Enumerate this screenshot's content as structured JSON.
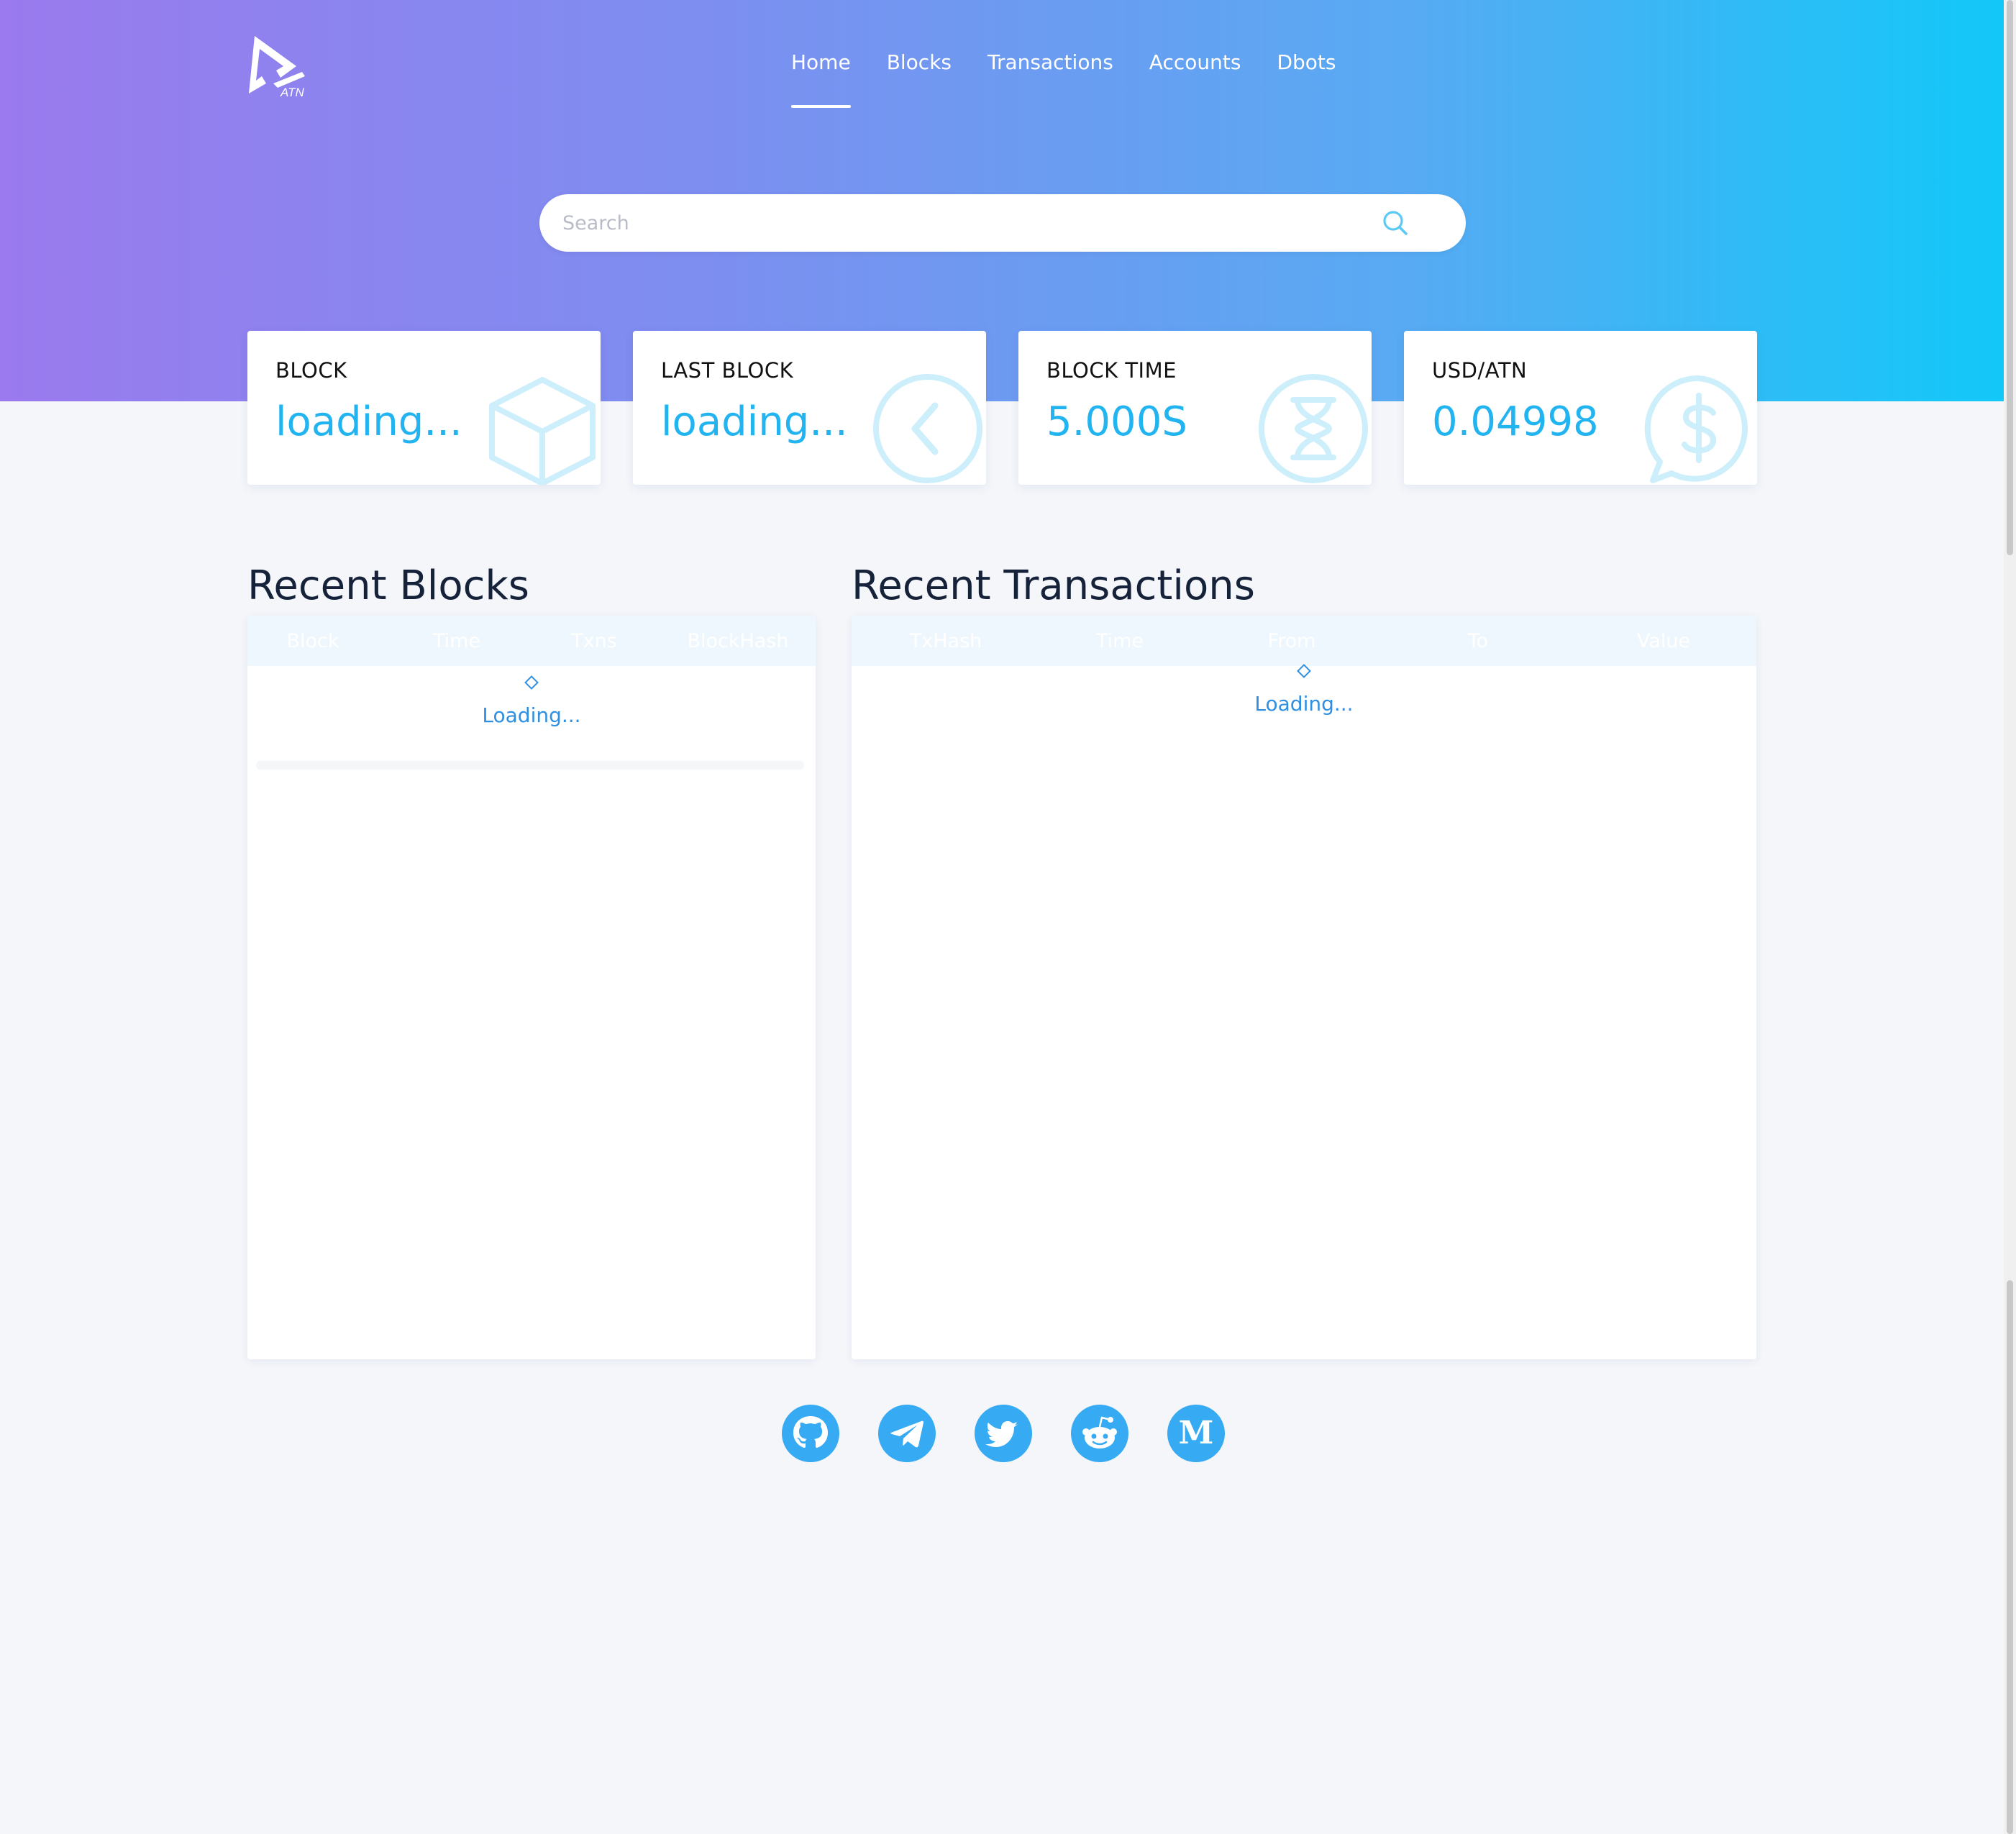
{
  "header": {
    "logo_text": "ATN",
    "nav": [
      {
        "label": "Home",
        "active": true
      },
      {
        "label": "Blocks",
        "active": false
      },
      {
        "label": "Transactions",
        "active": false
      },
      {
        "label": "Accounts",
        "active": false
      },
      {
        "label": "Dbots",
        "active": false
      }
    ]
  },
  "search": {
    "placeholder": "Search",
    "value": "",
    "icon": "search-icon"
  },
  "stats": [
    {
      "label": "BLOCK",
      "value": "loading...",
      "icon": "cube-icon"
    },
    {
      "label": "LAST BLOCK",
      "value": "loading...",
      "icon": "chevron-left-icon"
    },
    {
      "label": "BLOCK TIME",
      "value": "5.000S",
      "icon": "hourglass-icon"
    },
    {
      "label": "USD/ATN",
      "value": "0.04998",
      "icon": "dollar-chat-icon"
    }
  ],
  "recent_blocks": {
    "title": "Recent Blocks",
    "columns": [
      "Block",
      "Time",
      "Txns",
      "BlockHash"
    ],
    "loading_text": "Loading...",
    "rows": []
  },
  "recent_transactions": {
    "title": "Recent Transactions",
    "columns": [
      "TxHash",
      "Time",
      "From",
      "To",
      "Value"
    ],
    "loading_text": "Loading...",
    "rows": []
  },
  "social_links": [
    {
      "name": "GitHub",
      "icon": "github-icon"
    },
    {
      "name": "Telegram",
      "icon": "telegram-icon"
    },
    {
      "name": "Twitter",
      "icon": "twitter-icon"
    },
    {
      "name": "Reddit",
      "icon": "reddit-icon"
    },
    {
      "name": "Medium",
      "icon": "medium-icon",
      "glyph": "M"
    }
  ],
  "colors": {
    "gradient_start": "#9a7aee",
    "gradient_end": "#12c8f8",
    "accent": "#22b4f0",
    "loading_blue": "#2f8fe0",
    "social_blue": "#36aaf2",
    "page_background": "#f4f6fa",
    "table_header_bg": "#eef7fd"
  }
}
